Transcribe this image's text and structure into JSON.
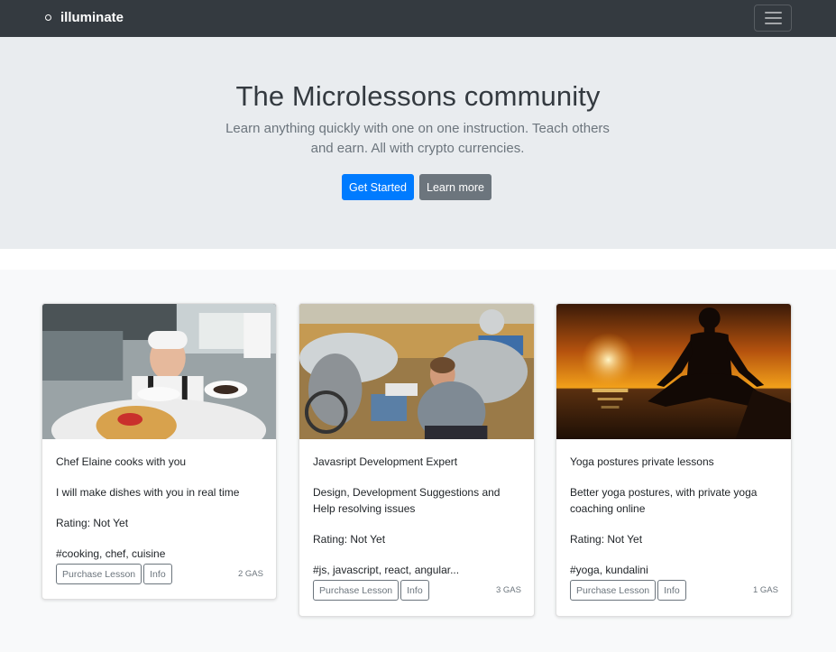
{
  "nav": {
    "brand": "illuminate",
    "toggler_icon": "hamburger-icon"
  },
  "hero": {
    "title": "The Microlessons community",
    "lead": "Learn anything quickly with one on one instruction. Teach others and earn. All with crypto currencies.",
    "primary_label": "Get Started",
    "secondary_label": "Learn more"
  },
  "lessons": [
    {
      "image": "chef-photo",
      "title": "Chef Elaine cooks with you",
      "description": "I will make dishes with you in real time",
      "rating": "Rating: Not Yet",
      "tags": "#cooking, chef, cuisine",
      "purchase_label": "Purchase Lesson",
      "info_label": "Info",
      "price": "2 GAS"
    },
    {
      "image": "developer-photo",
      "title": "Javasript Development Expert",
      "description": "Design, Development Suggestions and Help resolving issues",
      "rating": "Rating: Not Yet",
      "tags": "#js, javascript, react, angular...",
      "purchase_label": "Purchase Lesson",
      "info_label": "Info",
      "price": "3 GAS"
    },
    {
      "image": "yoga-photo",
      "title": "Yoga postures private lessons",
      "description": "Better yoga postures, with private yoga coaching online",
      "rating": "Rating: Not Yet",
      "tags": "#yoga, kundalini",
      "purchase_label": "Purchase Lesson",
      "info_label": "Info",
      "price": "1 GAS"
    }
  ],
  "colors": {
    "navbar": "#343a40",
    "jumbotron": "#e9ecef",
    "primary": "#007bff",
    "secondary": "#6c757d"
  }
}
